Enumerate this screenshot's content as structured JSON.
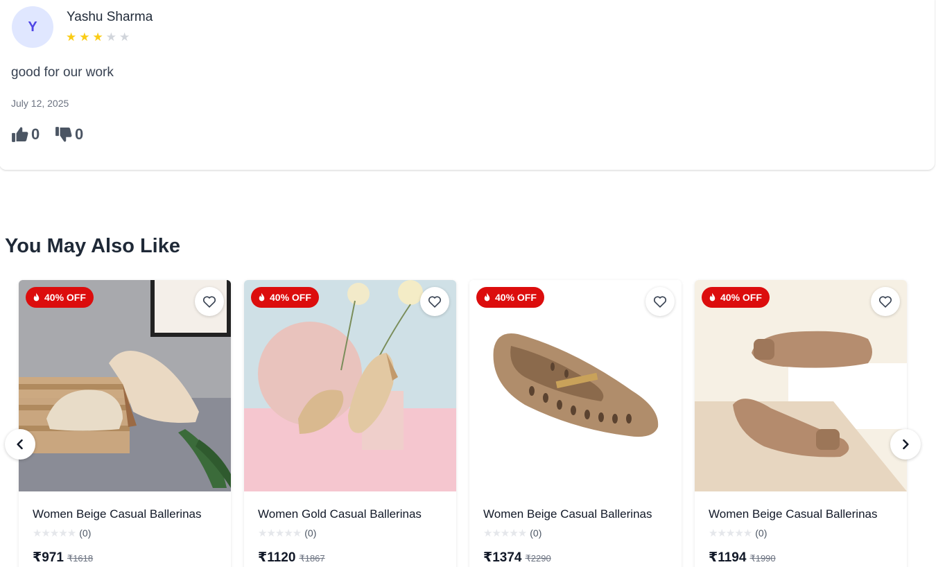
{
  "review": {
    "avatar_initial": "Y",
    "reviewer_name": "Yashu Sharma",
    "rating": 3,
    "rating_max": 5,
    "text": "good for our work",
    "date": "July 12, 2025",
    "likes": "0",
    "dislikes": "0"
  },
  "section": {
    "title": "You May Also Like"
  },
  "products": [
    {
      "badge": "40% OFF",
      "title": "Women Beige Casual Ballerinas",
      "rating_count": "(0)",
      "price": "₹971",
      "mrp": "₹1618",
      "image": "beige-wedge-pumps"
    },
    {
      "badge": "40% OFF",
      "title": "Women Gold Casual Ballerinas",
      "rating_count": "(0)",
      "price": "₹1120",
      "mrp": "₹1867",
      "image": "gold-ballerinas"
    },
    {
      "badge": "40% OFF",
      "title": "Women Beige Casual Ballerinas",
      "rating_count": "(0)",
      "price": "₹1374",
      "mrp": "₹2290",
      "image": "perforated-beige-flat"
    },
    {
      "badge": "40% OFF",
      "title": "Women Beige Casual Ballerinas",
      "rating_count": "(0)",
      "price": "₹1194",
      "mrp": "₹1990",
      "image": "tan-buckle-ballerinas"
    }
  ],
  "icons": {
    "like": "thumbs-up-icon",
    "dislike": "thumbs-down-icon",
    "badge": "flame-icon",
    "wishlist": "heart-icon",
    "prev": "chevron-left-icon",
    "next": "chevron-right-icon"
  },
  "colors": {
    "badge": "#dc0d0d",
    "star_filled": "#facc15",
    "star_empty": "#d1d5db",
    "avatar_bg": "#e0e7ff",
    "avatar_text": "#4f46e5"
  }
}
